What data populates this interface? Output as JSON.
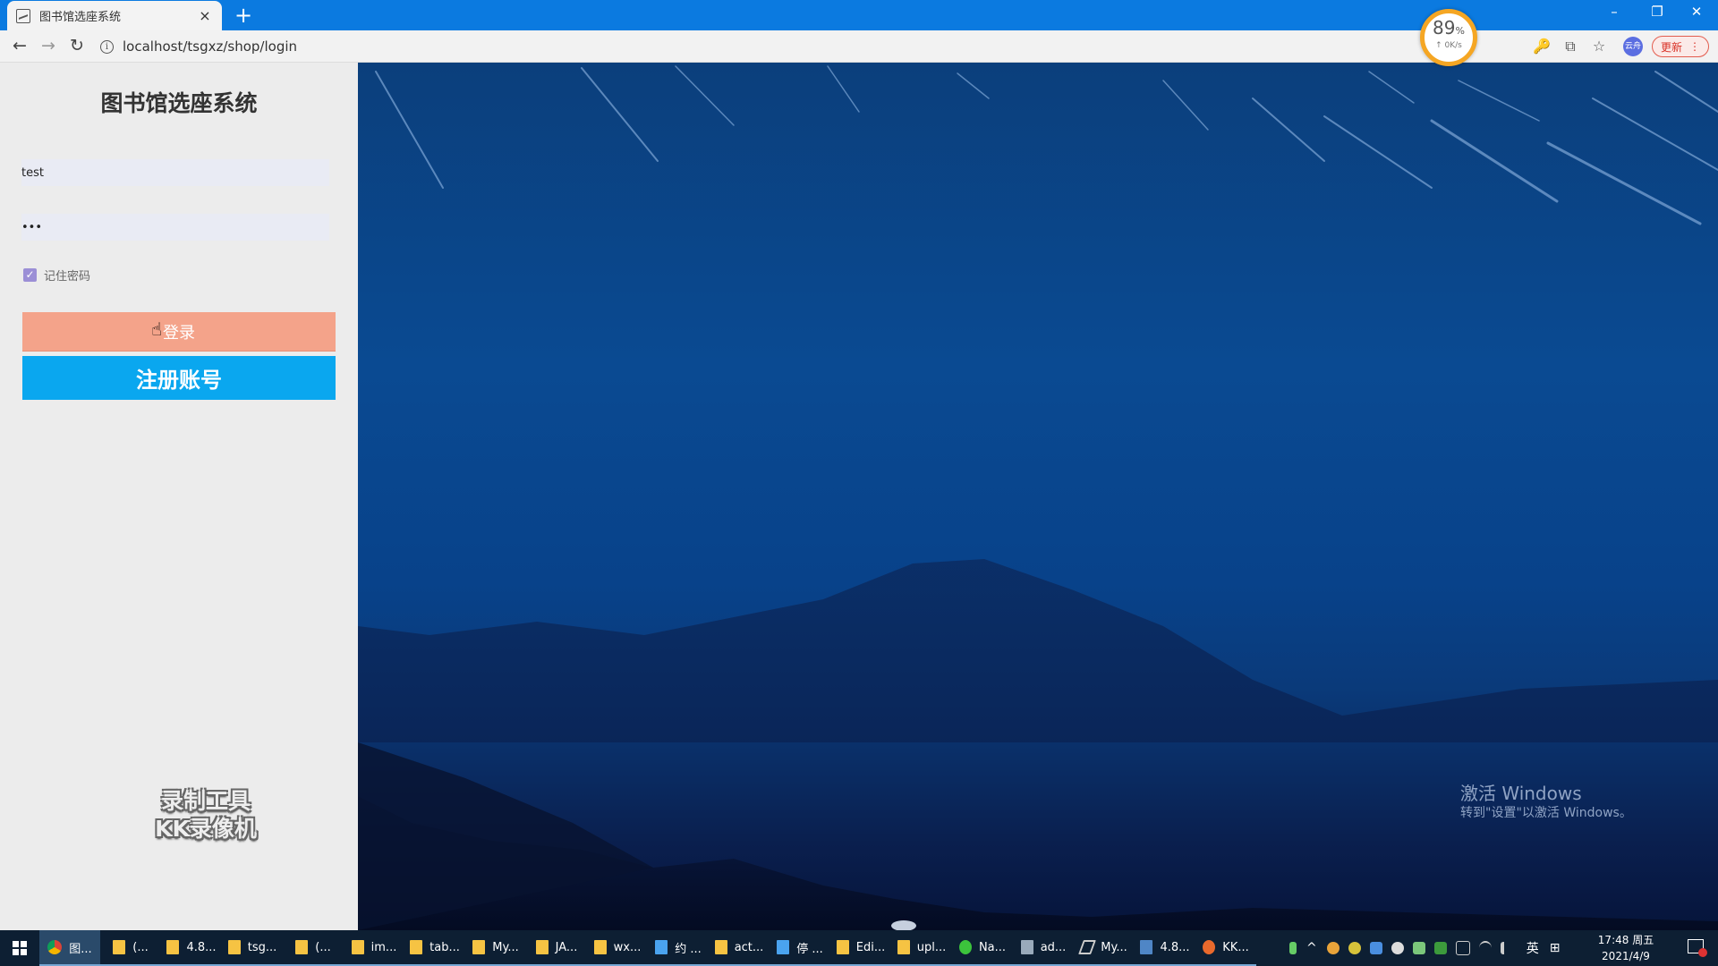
{
  "browser": {
    "tab_title": "图书馆选座系统",
    "tab_close": "×",
    "new_tab": "+",
    "url": "localhost/tsgxz/shop/login",
    "update_label": "更新",
    "profile_label": "云舟",
    "window_controls": {
      "minimize": "–",
      "restore": "❐",
      "close": "✕"
    },
    "nav": {
      "back": "←",
      "forward": "→",
      "reload": "↻"
    },
    "icons": {
      "key": "🔑",
      "translate": "⧉",
      "star": "☆",
      "menu": "⋮",
      "info": "i"
    }
  },
  "speed_gauge": {
    "percent": "89",
    "percent_unit": "%",
    "rate": "↑ 0K/s"
  },
  "login": {
    "title": "图书馆选座系统",
    "username_value": "test",
    "password_value": "•••",
    "remember_label": "记住密码",
    "remember_checked": true,
    "checkmark": "✓",
    "login_label": "登录",
    "register_label": "注册账号",
    "cursor": "☝"
  },
  "watermark": {
    "line1": "录制工具",
    "line2": "KK录像机"
  },
  "activation": {
    "line1": "激活 Windows",
    "line2": "转到\"设置\"以激活 Windows。"
  },
  "taskbar": {
    "items": [
      {
        "label": "图...",
        "icon": "chrome-icon",
        "active": true
      },
      {
        "label": "(...",
        "icon": "folder-icon"
      },
      {
        "label": "4.8...",
        "icon": "folder-icon"
      },
      {
        "label": "tsg...",
        "icon": "folder-icon"
      },
      {
        "label": "(...",
        "icon": "folder-icon"
      },
      {
        "label": "im...",
        "icon": "folder-icon"
      },
      {
        "label": "tab...",
        "icon": "folder-icon"
      },
      {
        "label": "My...",
        "icon": "folder-icon"
      },
      {
        "label": "JA...",
        "icon": "folder-icon"
      },
      {
        "label": "wx...",
        "icon": "folder-icon"
      },
      {
        "label": "约 ...",
        "icon": "cube-icon"
      },
      {
        "label": "act...",
        "icon": "folder-icon"
      },
      {
        "label": "停 ...",
        "icon": "cube-icon"
      },
      {
        "label": "Edi...",
        "icon": "folder-icon"
      },
      {
        "label": "upl...",
        "icon": "folder-icon"
      },
      {
        "label": "Na...",
        "icon": "navicat-icon"
      },
      {
        "label": "ad...",
        "icon": "drive-icon"
      },
      {
        "label": "My...",
        "icon": "pen-icon"
      },
      {
        "label": "4.8...",
        "icon": "visual-studio-icon"
      },
      {
        "label": "KK...",
        "icon": "kk-recorder-icon"
      }
    ],
    "tray_lang": "英",
    "tray_caret": "^",
    "tray_grid": "⊞",
    "time": "17:48 周五",
    "date": "2021/4/9"
  }
}
